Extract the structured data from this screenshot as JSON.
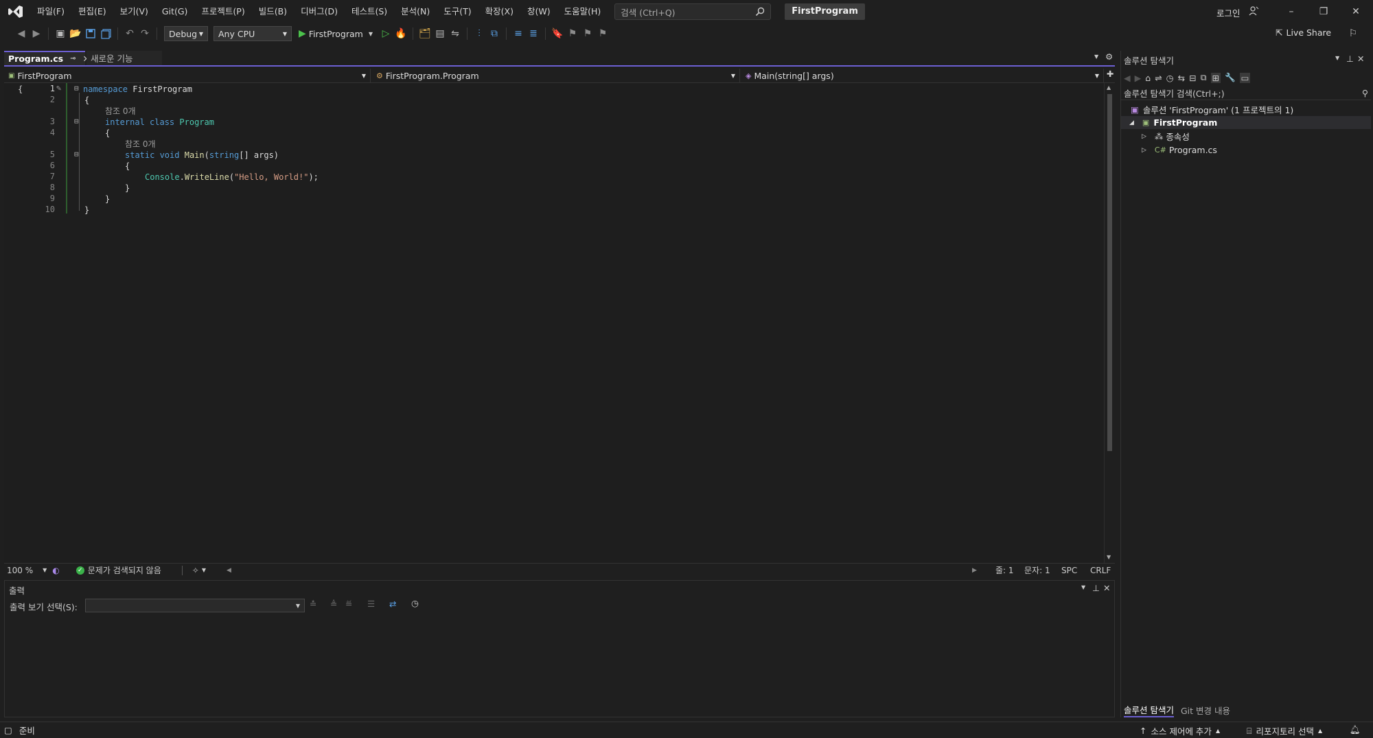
{
  "titlebar": {
    "menu": [
      "파일(F)",
      "편집(E)",
      "보기(V)",
      "Git(G)",
      "프로젝트(P)",
      "빌드(B)",
      "디버그(D)",
      "테스트(S)",
      "분석(N)",
      "도구(T)",
      "확장(X)",
      "창(W)",
      "도움말(H)"
    ],
    "search_placeholder": "검색 (Ctrl+Q)",
    "project_badge": "FirstProgram",
    "login": "로그인"
  },
  "toolbar": {
    "config": "Debug",
    "platform": "Any CPU",
    "run_target": "FirstProgram",
    "live_share": "Live Share"
  },
  "editor": {
    "tabs": [
      {
        "label": "Program.cs",
        "active": true
      },
      {
        "label": "새로운 기능",
        "active": false
      }
    ],
    "nav": {
      "project": "FirstProgram",
      "type": "FirstProgram.Program",
      "member": "Main(string[] args)"
    },
    "line_numbers": [
      "1",
      "2",
      "3",
      "4",
      "5",
      "6",
      "7",
      "8",
      "9",
      "10"
    ],
    "code": {
      "l1_kw": "namespace",
      "l1_name": " FirstProgram",
      "brace_open": "{",
      "brace_close": "}",
      "ref_label": "참조 0개",
      "l3_kw": "internal class",
      "l3_type": "Program",
      "l5_kw": "static void",
      "l5_fn": "Main",
      "l5_paren": "(",
      "l5_argtype": "string",
      "l5_rest": "[] args)",
      "l7_type": "Console",
      "l7_dot": ".",
      "l7_fn": "WriteLine",
      "l7_open": "(",
      "l7_str": "\"Hello, World!\"",
      "l7_close": ");"
    },
    "status": {
      "zoom": "100 %",
      "issues": "문제가 검색되지 않음",
      "line": "줄: 1",
      "col": "문자: 1",
      "spc": "SPC",
      "crlf": "CRLF"
    }
  },
  "output": {
    "title": "출력",
    "source_label": "출력 보기 선택(S):",
    "source_value": ""
  },
  "solution_explorer": {
    "title": "솔루션 탐색기",
    "search_placeholder": "솔루션 탐색기 검색(Ctrl+;)",
    "solution": "솔루션 'FirstProgram' (1 프로젝트의 1)",
    "project": "FirstProgram",
    "dependencies": "종속성",
    "file": "Program.cs",
    "bottom_tabs": [
      "솔루션 탐색기",
      "Git 변경 내용"
    ]
  },
  "statusbar": {
    "ready": "준비",
    "source_control": "소스 제어에 추가",
    "repository": "리포지토리 선택"
  },
  "colors": {
    "accent": "#6c5fd3",
    "background": "#1f1f1f",
    "keyword": "#569cd6",
    "type": "#4ec9b0",
    "string": "#d69d85"
  }
}
